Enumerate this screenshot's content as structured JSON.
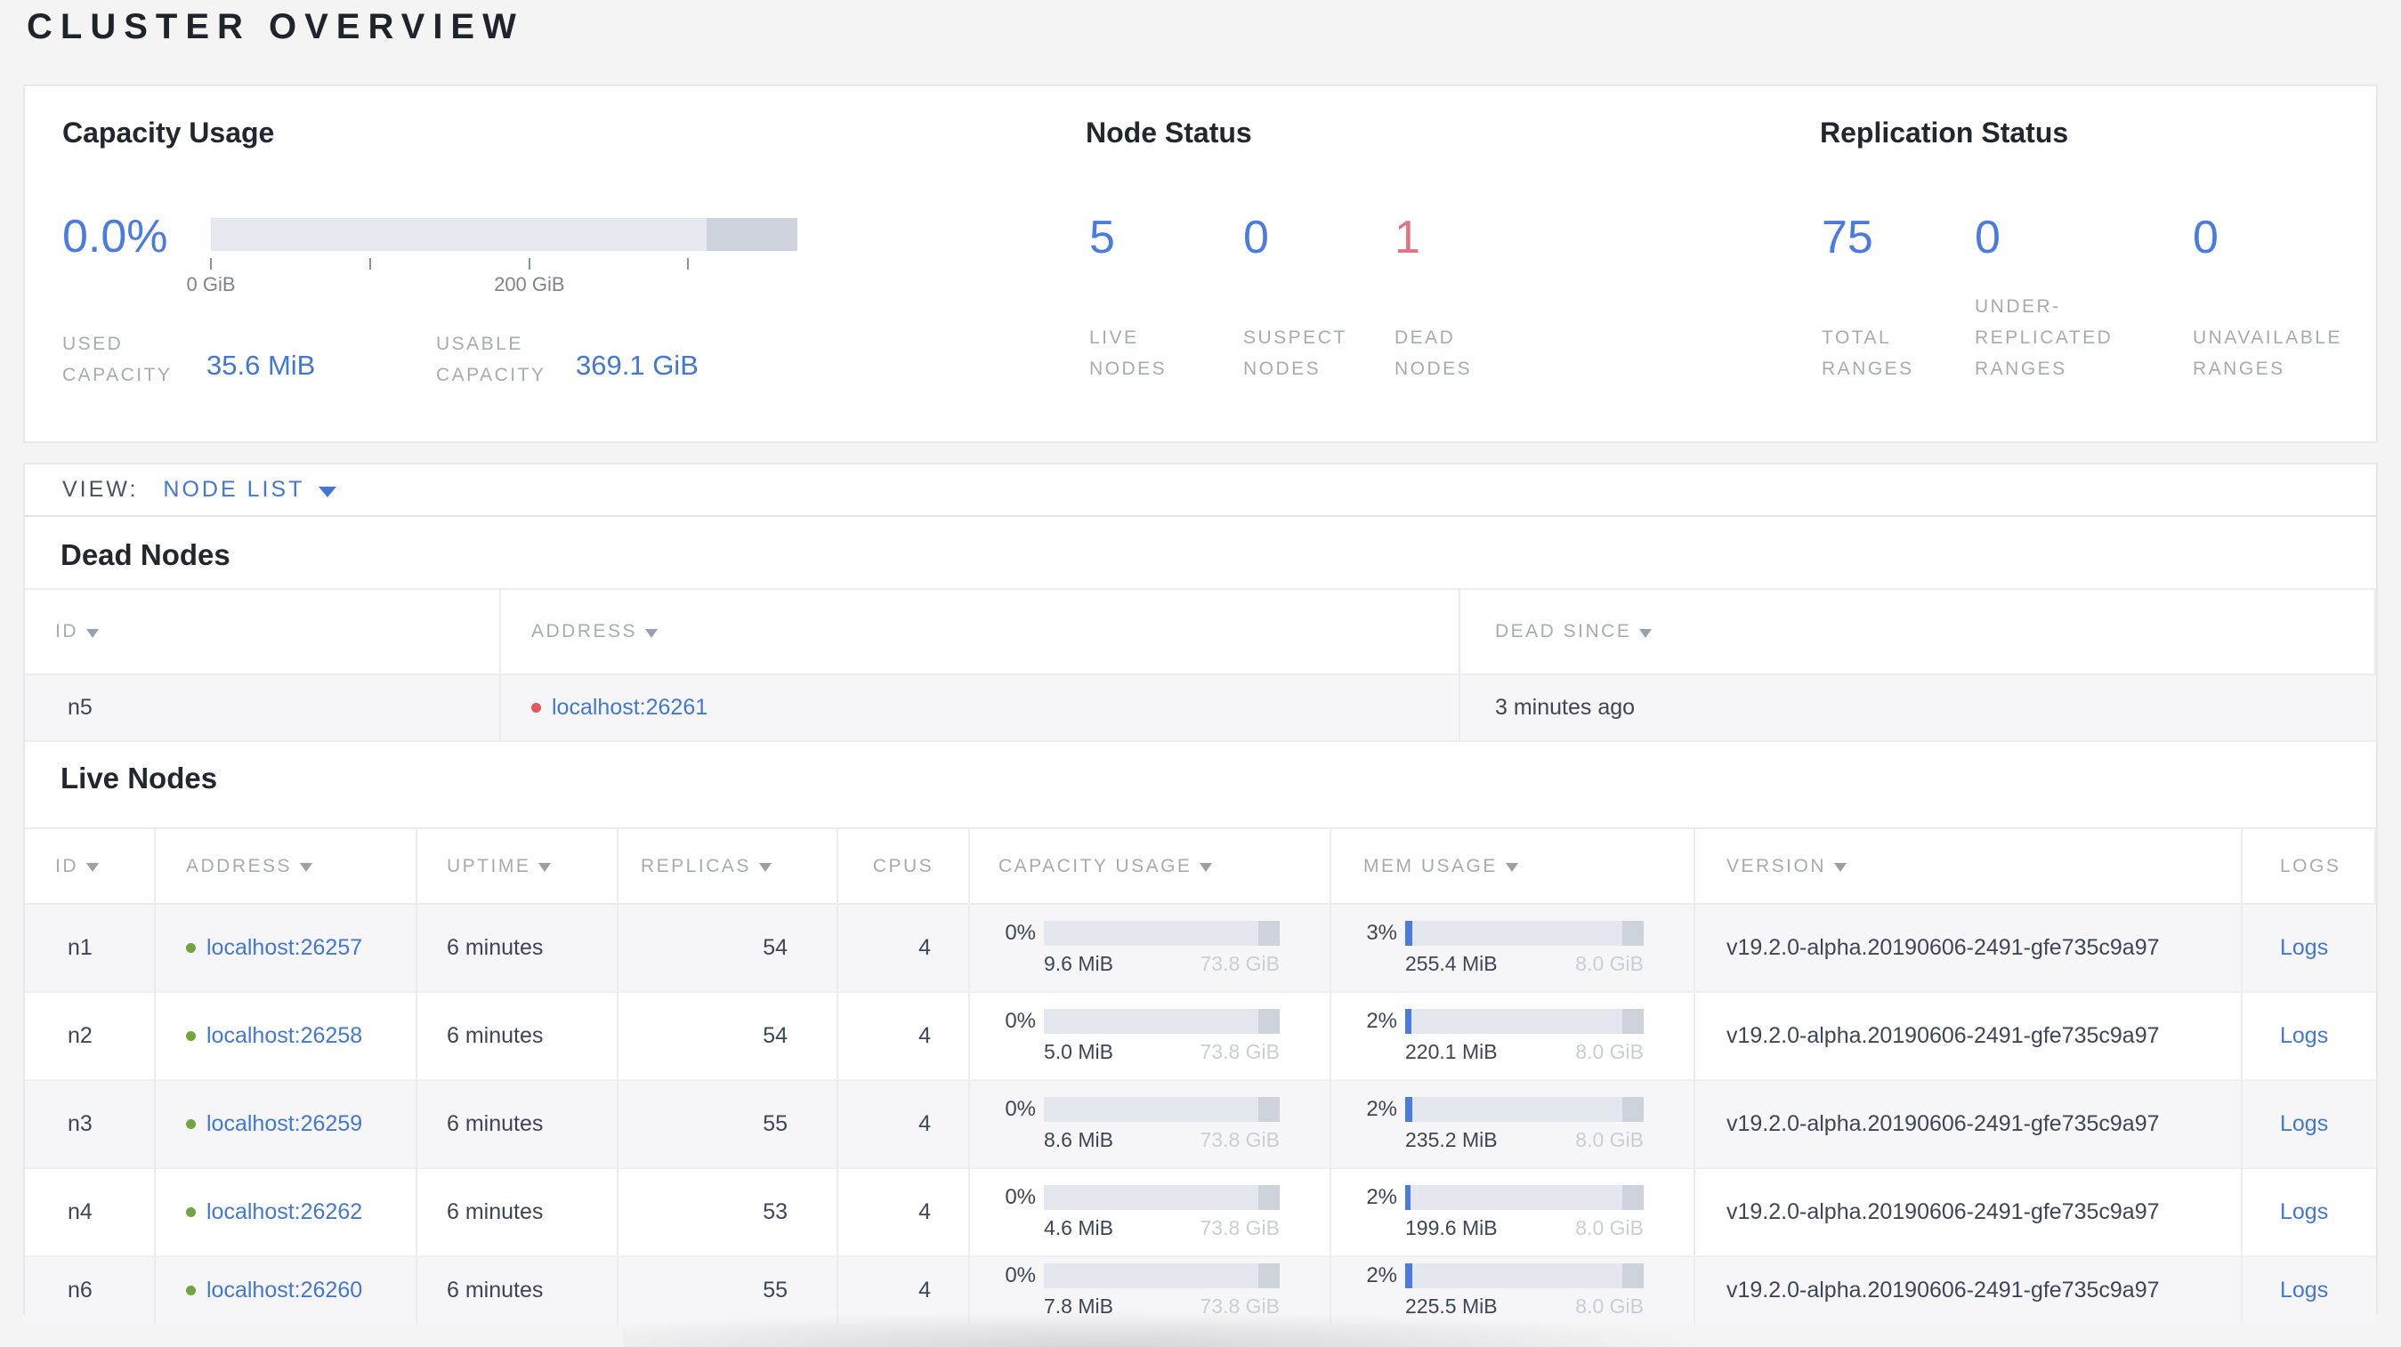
{
  "page": {
    "title": "CLUSTER OVERVIEW"
  },
  "palette": {
    "accent_blue": "#4a7be0",
    "link_blue": "#4277d3",
    "status_red": "#e3747f",
    "live_dot_green": "#71a53f",
    "dead_dot_red": "#e0575e"
  },
  "summary": {
    "capacity": {
      "title": "Capacity Usage",
      "percent": "0.0%",
      "bar": {
        "fill_width": "0%"
      },
      "ticks": [
        {
          "pos": "0%",
          "label": "0 GiB"
        },
        {
          "pos": "27.1%",
          "label": ""
        },
        {
          "pos": "54.3%",
          "label": "200 GiB"
        },
        {
          "pos": "81.4%",
          "label": ""
        }
      ],
      "stats": [
        {
          "lines": [
            "USED",
            "CAPACITY"
          ],
          "value": "35.6 MiB"
        },
        {
          "lines": [
            "USABLE",
            "CAPACITY"
          ],
          "value": "369.1 GiB"
        }
      ]
    },
    "nodes": {
      "title": "Node Status",
      "stats": [
        {
          "value": "5",
          "lines": [
            "LIVE",
            "NODES"
          ],
          "variant": "blue"
        },
        {
          "value": "0",
          "lines": [
            "SUSPECT",
            "NODES"
          ],
          "variant": "blue"
        },
        {
          "value": "1",
          "lines": [
            "DEAD",
            "NODES"
          ],
          "variant": "red"
        }
      ]
    },
    "replication": {
      "title": "Replication Status",
      "stats": [
        {
          "value": "75",
          "lines": [
            "TOTAL",
            "RANGES"
          ],
          "variant": "blue"
        },
        {
          "value": "0",
          "lines": [
            "UNDER-",
            "REPLICATED",
            "RANGES"
          ],
          "variant": "blue"
        },
        {
          "value": "0",
          "lines": [
            "UNAVAILABLE",
            "RANGES"
          ],
          "variant": "blue"
        }
      ]
    }
  },
  "view_bar": {
    "label": "VIEW:",
    "selected": "NODE LIST"
  },
  "dead_nodes": {
    "title": "Dead Nodes",
    "columns": [
      {
        "label": "ID",
        "sortable": true,
        "interactable": "true"
      },
      {
        "label": "ADDRESS",
        "sortable": true,
        "interactable": "true"
      },
      {
        "label": "DEAD SINCE",
        "sortable": true,
        "interactable": "true"
      }
    ],
    "rows": [
      {
        "id": "n5",
        "address": "localhost:26261",
        "dead_since": "3 minutes ago"
      }
    ]
  },
  "live_nodes": {
    "title": "Live Nodes",
    "columns": [
      {
        "label": "ID",
        "sortable": true,
        "interactable": "true"
      },
      {
        "label": "ADDRESS",
        "sortable": true,
        "interactable": "true"
      },
      {
        "label": "UPTIME",
        "sortable": true,
        "interactable": "true"
      },
      {
        "label": "REPLICAS",
        "sortable": true,
        "interactable": "true"
      },
      {
        "label": "CPUS",
        "sortable": false,
        "interactable": "false"
      },
      {
        "label": "CAPACITY USAGE",
        "sortable": true,
        "interactable": "true"
      },
      {
        "label": "MEM USAGE",
        "sortable": true,
        "interactable": "true"
      },
      {
        "label": "VERSION",
        "sortable": true,
        "interactable": "true"
      },
      {
        "label": "LOGS",
        "sortable": false,
        "interactable": "false"
      }
    ],
    "rows": [
      {
        "id": "n1",
        "address": "localhost:26257",
        "uptime": "6 minutes",
        "replicas": "54",
        "cpus": "4",
        "capacity": {
          "pct": "0%",
          "fill": "0%",
          "used": "9.6 MiB",
          "total": "73.8 GiB"
        },
        "mem": {
          "pct": "3%",
          "fill": "3.1%",
          "used": "255.4 MiB",
          "total": "8.0 GiB"
        },
        "version": "v19.2.0-alpha.20190606-2491-gfe735c9a97",
        "logs": "Logs"
      },
      {
        "id": "n2",
        "address": "localhost:26258",
        "uptime": "6 minutes",
        "replicas": "54",
        "cpus": "4",
        "capacity": {
          "pct": "0%",
          "fill": "0%",
          "used": "5.0 MiB",
          "total": "73.8 GiB"
        },
        "mem": {
          "pct": "2%",
          "fill": "2.7%",
          "used": "220.1 MiB",
          "total": "8.0 GiB"
        },
        "version": "v19.2.0-alpha.20190606-2491-gfe735c9a97",
        "logs": "Logs"
      },
      {
        "id": "n3",
        "address": "localhost:26259",
        "uptime": "6 minutes",
        "replicas": "55",
        "cpus": "4",
        "capacity": {
          "pct": "0%",
          "fill": "0%",
          "used": "8.6 MiB",
          "total": "73.8 GiB"
        },
        "mem": {
          "pct": "2%",
          "fill": "2.9%",
          "used": "235.2 MiB",
          "total": "8.0 GiB"
        },
        "version": "v19.2.0-alpha.20190606-2491-gfe735c9a97",
        "logs": "Logs"
      },
      {
        "id": "n4",
        "address": "localhost:26262",
        "uptime": "6 minutes",
        "replicas": "53",
        "cpus": "4",
        "capacity": {
          "pct": "0%",
          "fill": "0%",
          "used": "4.6 MiB",
          "total": "73.8 GiB"
        },
        "mem": {
          "pct": "2%",
          "fill": "2.4%",
          "used": "199.6 MiB",
          "total": "8.0 GiB"
        },
        "version": "v19.2.0-alpha.20190606-2491-gfe735c9a97",
        "logs": "Logs"
      },
      {
        "id": "n6",
        "address": "localhost:26260",
        "uptime": "6 minutes",
        "replicas": "55",
        "cpus": "4",
        "capacity": {
          "pct": "0%",
          "fill": "0%",
          "used": "7.8 MiB",
          "total": "73.8 GiB"
        },
        "mem": {
          "pct": "2%",
          "fill": "2.8%",
          "used": "225.5 MiB",
          "total": "8.0 GiB"
        },
        "version": "v19.2.0-alpha.20190606-2491-gfe735c9a97",
        "logs": "Logs"
      }
    ]
  }
}
